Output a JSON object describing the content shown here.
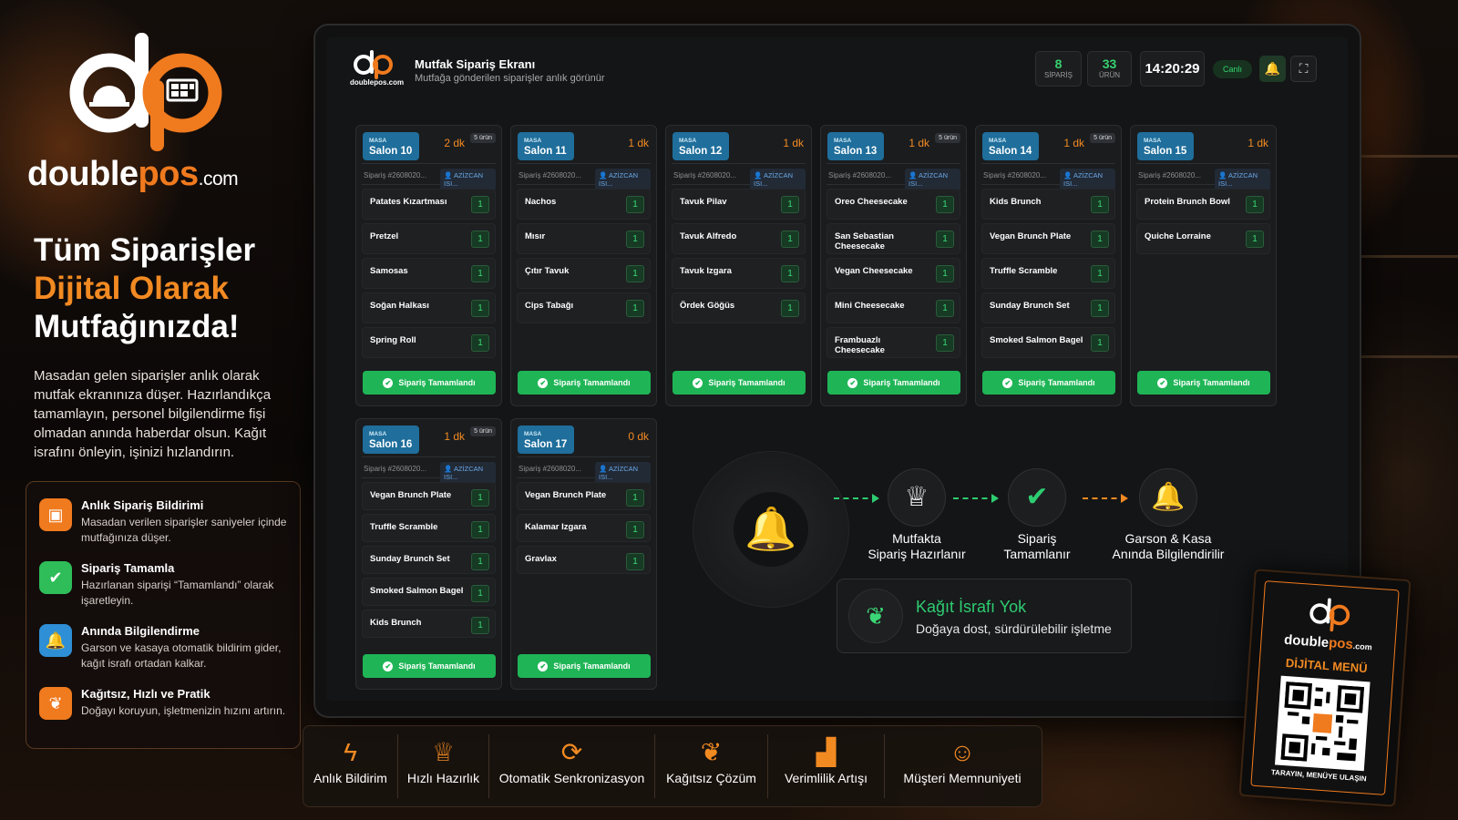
{
  "brand": {
    "name_a": "double",
    "name_b": "pos",
    "name_c": ".com"
  },
  "headline": {
    "l1": "Tüm Siparişler",
    "l2": "Dijital Olarak",
    "l3": "Mutfağınızda!"
  },
  "intro": "Masadan gelen siparişler anlık olarak mutfak ekranınıza düşer. Hazırlandıkça tamamlayın, personel bilgilendirme fişi olmadan anında haberdar olsun. Kağıt israfını önleyin, işinizi hızlandırın.",
  "features": [
    {
      "title": "Anlık Sipariş Bildirimi",
      "desc": "Masadan verilen siparişler saniyeler içinde mutfağınıza düşer.",
      "icon": "monitor-icon",
      "color": "#f07a1e"
    },
    {
      "title": "Sipariş Tamamla",
      "desc": "Hazırlanan siparişi “Tamamlandı” olarak işaretleyin.",
      "icon": "check-icon",
      "color": "#2ebd59"
    },
    {
      "title": "Anında Bilgilendirme",
      "desc": "Garson ve kasaya otomatik bildirim gider, kağıt israfı ortadan kalkar.",
      "icon": "bell-icon",
      "color": "#2e8fd6"
    },
    {
      "title": "Kağıtsız, Hızlı ve Pratik",
      "desc": "Doğayı koruyun, işletmenizin hızını artırın.",
      "icon": "leaf-icon",
      "color": "#f07a1e"
    }
  ],
  "app": {
    "logo_text": "doublepos.com",
    "title": "Mutfak Sipariş Ekranı",
    "subtitle": "Mutfağa gönderilen siparişler anlık görünür",
    "orders_count": "8",
    "orders_label": "SİPARİŞ",
    "items_count": "33",
    "items_label": "ÜRÜN",
    "clock": "14:20:29",
    "live": "Canlı"
  },
  "orders": [
    {
      "masa": "MASA",
      "table": "Salon 10",
      "time": "2 dk",
      "count": "5 ürün",
      "no": "Sipariş #2608020...",
      "user": "AZİZCAN ISI...",
      "items": [
        {
          "n": "Patates Kızartması",
          "q": "1"
        },
        {
          "n": "Pretzel",
          "q": "1"
        },
        {
          "n": "Samosas",
          "q": "1"
        },
        {
          "n": "Soğan Halkası",
          "q": "1"
        },
        {
          "n": "Spring Roll",
          "q": "1"
        }
      ],
      "done": "Sipariş Tamamlandı"
    },
    {
      "masa": "MASA",
      "table": "Salon 11",
      "time": "1 dk",
      "count": "",
      "no": "Sipariş #2608020...",
      "user": "AZİZCAN ISI...",
      "items": [
        {
          "n": "Nachos",
          "q": "1"
        },
        {
          "n": "Mısır",
          "q": "1"
        },
        {
          "n": "Çıtır Tavuk",
          "q": "1"
        },
        {
          "n": "Cips Tabağı",
          "q": "1"
        }
      ],
      "done": "Sipariş Tamamlandı"
    },
    {
      "masa": "MASA",
      "table": "Salon 12",
      "time": "1 dk",
      "count": "",
      "no": "Sipariş #2608020...",
      "user": "AZİZCAN ISI...",
      "items": [
        {
          "n": "Tavuk Pilav",
          "q": "1"
        },
        {
          "n": "Tavuk Alfredo",
          "q": "1"
        },
        {
          "n": "Tavuk Izgara",
          "q": "1"
        },
        {
          "n": "Ördek Göğüs",
          "q": "1"
        }
      ],
      "done": "Sipariş Tamamlandı"
    },
    {
      "masa": "MASA",
      "table": "Salon 13",
      "time": "1 dk",
      "count": "5 ürün",
      "no": "Sipariş #2608020...",
      "user": "AZİZCAN ISI...",
      "items": [
        {
          "n": "Oreo Cheesecake",
          "q": "1"
        },
        {
          "n": "San Sebastian Cheesecake",
          "q": "1"
        },
        {
          "n": "Vegan Cheesecake",
          "q": "1"
        },
        {
          "n": "Mini Cheesecake",
          "q": "1"
        },
        {
          "n": "Frambuazlı Cheesecake",
          "q": "1"
        }
      ],
      "done": "Sipariş Tamamlandı"
    },
    {
      "masa": "MASA",
      "table": "Salon 14",
      "time": "1 dk",
      "count": "5 ürün",
      "no": "Sipariş #2608020...",
      "user": "AZİZCAN ISI...",
      "items": [
        {
          "n": "Kids Brunch",
          "q": "1"
        },
        {
          "n": "Vegan Brunch Plate",
          "q": "1"
        },
        {
          "n": "Truffle Scramble",
          "q": "1"
        },
        {
          "n": "Sunday Brunch Set",
          "q": "1"
        },
        {
          "n": "Smoked Salmon Bagel",
          "q": "1"
        }
      ],
      "done": "Sipariş Tamamlandı"
    },
    {
      "masa": "MASA",
      "table": "Salon 15",
      "time": "1 dk",
      "count": "",
      "no": "Sipariş #2608020...",
      "user": "AZİZCAN ISI...",
      "items": [
        {
          "n": "Protein Brunch Bowl",
          "q": "1"
        },
        {
          "n": "Quiche Lorraine",
          "q": "1"
        }
      ],
      "done": "Sipariş Tamamlandı"
    },
    {
      "masa": "MASA",
      "table": "Salon 16",
      "time": "1 dk",
      "count": "5 ürün",
      "no": "Sipariş #2608020...",
      "user": "AZİZCAN ISI...",
      "items": [
        {
          "n": "Vegan Brunch Plate",
          "q": "1"
        },
        {
          "n": "Truffle Scramble",
          "q": "1"
        },
        {
          "n": "Sunday Brunch Set",
          "q": "1"
        },
        {
          "n": "Smoked Salmon Bagel",
          "q": "1"
        },
        {
          "n": "Kids Brunch",
          "q": "1"
        }
      ],
      "done": "Sipariş Tamamlandı"
    },
    {
      "masa": "MASA",
      "table": "Salon 17",
      "time": "0 dk",
      "count": "",
      "no": "Sipariş #2608020...",
      "user": "AZİZCAN ISI...",
      "items": [
        {
          "n": "Vegan Brunch Plate",
          "q": "1"
        },
        {
          "n": "Kalamar Izgara",
          "q": "1"
        },
        {
          "n": "Gravlax",
          "q": "1"
        }
      ],
      "done": "Sipariş Tamamlandı"
    }
  ],
  "flow": {
    "s1a": "Mutfakta",
    "s1b": "Sipariş Hazırlanır",
    "s2a": "Sipariş",
    "s2b": "Tamamlanır",
    "s3a": "Garson & Kasa",
    "s3b": "Anında Bilgilendirilir"
  },
  "paper": {
    "title": "Kağıt İsrafı Yok",
    "sub": "Doğaya dost, sürdürülebilir işletme"
  },
  "bottom": [
    {
      "label": "Anlık Bildirim",
      "icon": "lightning-icon"
    },
    {
      "label": "Hızlı Hazırlık",
      "icon": "chef-hat-icon"
    },
    {
      "label": "Otomatik Senkronizasyon",
      "icon": "sync-icon"
    },
    {
      "label": "Kağıtsız Çözüm",
      "icon": "leaf-icon"
    },
    {
      "label": "Verimlilik Artışı",
      "icon": "chart-icon"
    },
    {
      "label": "Müşteri Memnuniyeti",
      "icon": "smile-icon"
    }
  ],
  "stand": {
    "name_a": "double",
    "name_b": "pos",
    "name_c": ".com",
    "menu": "DİJİTAL MENÜ",
    "cta": "TARAYIN, MENÜYE ULAŞIN"
  }
}
